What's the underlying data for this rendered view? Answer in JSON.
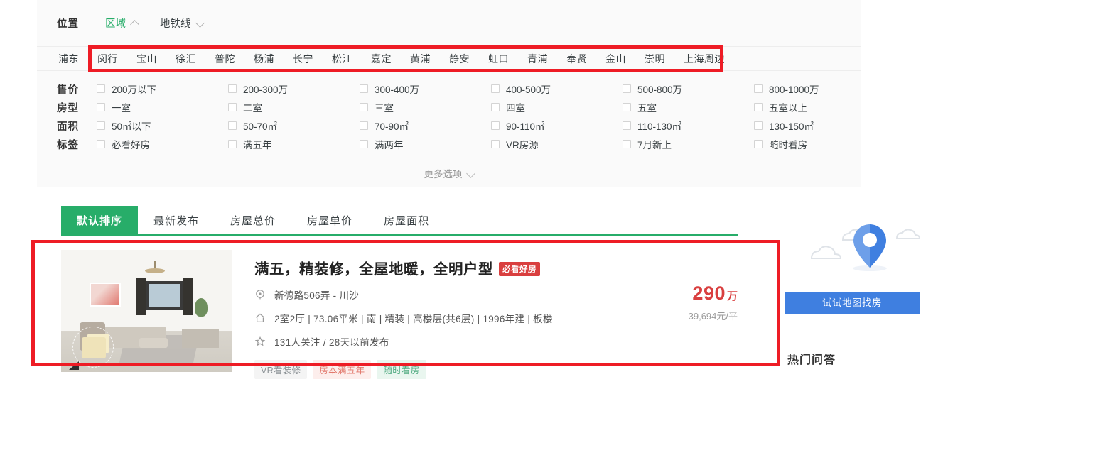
{
  "filter": {
    "location_label": "位置",
    "tabs": [
      {
        "name": "region",
        "label": "区域",
        "active": true,
        "chevron": "chevron-up-icon"
      },
      {
        "name": "metro",
        "label": "地铁线",
        "active": false,
        "chevron": "chevron-down-icon"
      }
    ],
    "districts": [
      "浦东",
      "闵行",
      "宝山",
      "徐汇",
      "普陀",
      "杨浦",
      "长宁",
      "松江",
      "嘉定",
      "黄浦",
      "静安",
      "虹口",
      "青浦",
      "奉贤",
      "金山",
      "崇明",
      "上海周边"
    ],
    "facets": [
      {
        "label": "售价",
        "options": [
          "200万以下",
          "200-300万",
          "300-400万",
          "400-500万",
          "500-800万",
          "800-1000万"
        ]
      },
      {
        "label": "房型",
        "options": [
          "一室",
          "二室",
          "三室",
          "四室",
          "五室",
          "五室以上"
        ]
      },
      {
        "label": "面积",
        "options": [
          "50㎡以下",
          "50-70㎡",
          "70-90㎡",
          "90-110㎡",
          "110-130㎡",
          "130-150㎡"
        ]
      },
      {
        "label": "标签",
        "options": [
          "必看好房",
          "满五年",
          "满两年",
          "VR房源",
          "7月新上",
          "随时看房"
        ]
      }
    ],
    "more_label": "更多选项"
  },
  "sort": {
    "tabs": [
      {
        "label": "默认排序",
        "active": true
      },
      {
        "label": "最新发布",
        "active": false
      },
      {
        "label": "房屋总价",
        "active": false
      },
      {
        "label": "房屋单价",
        "active": false
      },
      {
        "label": "房屋面积",
        "active": false
      }
    ]
  },
  "listing": {
    "title": "满五，精装修，全屋地暖，全明户型",
    "badge": "必看好房",
    "address": "新德路506弄 - 川沙",
    "details": "2室2厅 | 73.06平米 | 南 | 精装 | 高楼层(共6层) | 1996年建 | 板楼",
    "stats": "131人关注 / 28天以前发布",
    "chips": [
      {
        "label": "VR看装修",
        "style": "gray"
      },
      {
        "label": "房本满五年",
        "style": "red"
      },
      {
        "label": "随时看房",
        "style": "green"
      }
    ],
    "price_total": "290",
    "price_total_unit": "万",
    "price_unit": "39,694元/平"
  },
  "right_rail": {
    "map_cta": "试试地图找房",
    "hot_qa_title": "热门问答"
  },
  "colors": {
    "brand_green": "#27ad69",
    "price_red": "#d93f3f",
    "annotation_red": "#ee1c25",
    "cta_blue": "#3f7fe0"
  }
}
